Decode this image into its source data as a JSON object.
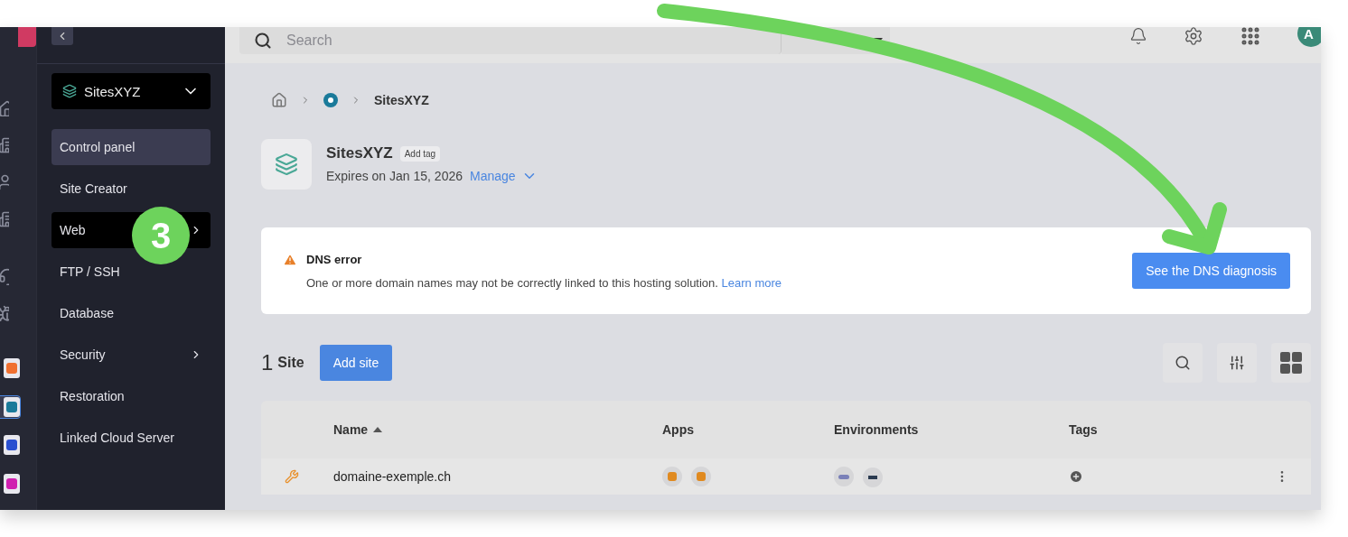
{
  "header": {
    "search": {
      "placeholder": "Search"
    },
    "avatar": "A"
  },
  "sidebar": {
    "product": "SitesXYZ",
    "items": [
      {
        "label": "Control panel",
        "selected": true,
        "highlighted": false,
        "submenu": false
      },
      {
        "label": "Site Creator",
        "selected": false,
        "highlighted": false,
        "submenu": false
      },
      {
        "label": "Web",
        "selected": false,
        "highlighted": true,
        "submenu": true
      },
      {
        "label": "FTP / SSH",
        "selected": false,
        "highlighted": false,
        "submenu": false
      },
      {
        "label": "Database",
        "selected": false,
        "highlighted": false,
        "submenu": false
      },
      {
        "label": "Security",
        "selected": false,
        "highlighted": false,
        "submenu": true
      },
      {
        "label": "Restoration",
        "selected": false,
        "highlighted": false,
        "submenu": false
      },
      {
        "label": "Linked Cloud Server",
        "selected": false,
        "highlighted": false,
        "submenu": false
      }
    ]
  },
  "rail": {
    "apps": [
      {
        "color": "#f07030",
        "selected": false
      },
      {
        "color": "#1a7a9a",
        "selected": true
      },
      {
        "color": "#2a50d0",
        "selected": false
      },
      {
        "color": "#d020b0",
        "selected": false
      }
    ]
  },
  "breadcrumb": {
    "current": "SitesXYZ"
  },
  "product": {
    "title": "SitesXYZ",
    "tag_button": "Add tag",
    "expiry": "Expires on Jan 15, 2026",
    "manage": "Manage"
  },
  "alert": {
    "title": "DNS error",
    "message": "One or more domain names may not be correctly linked to this hosting solution.",
    "link": "Learn more",
    "button": "See the DNS diagnosis"
  },
  "sites": {
    "count": "1",
    "label": "Site",
    "add_button": "Add site"
  },
  "table": {
    "columns": [
      {
        "label": "Name",
        "sorted": true
      },
      {
        "label": "Apps",
        "sorted": false
      },
      {
        "label": "Environments",
        "sorted": false
      },
      {
        "label": "Tags",
        "sorted": false
      }
    ],
    "rows": [
      {
        "name": "domaine-exemple.ch"
      }
    ]
  },
  "annotation": {
    "step": "3"
  }
}
